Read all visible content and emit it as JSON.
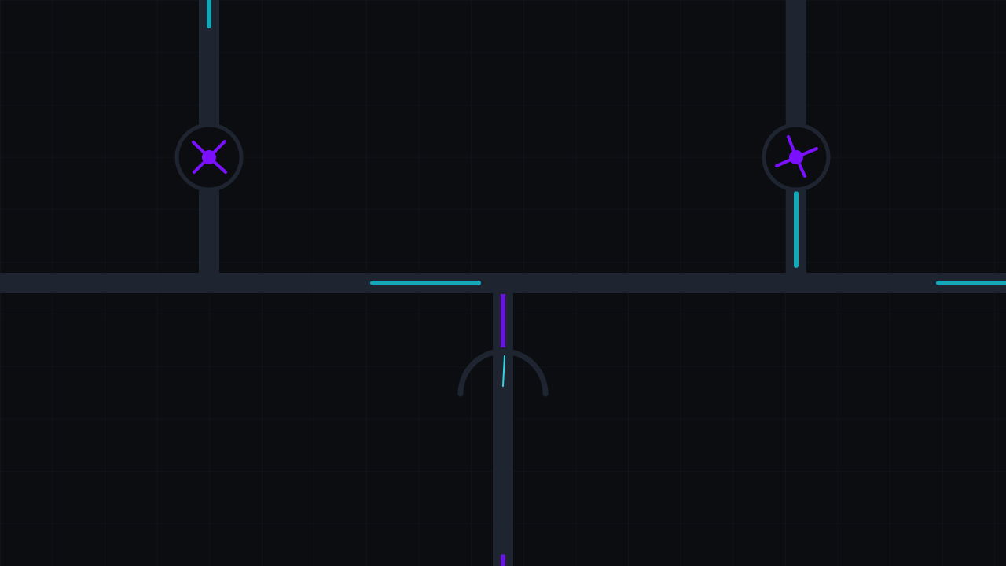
{
  "colors": {
    "background": "#0b0d11",
    "grid": "#141821",
    "pipe": "#1f2530",
    "cyan": "#12a8b8",
    "cyan_bright": "#2fd6e6",
    "purple": "#7b10ff",
    "purple_dark": "#5a10c8"
  },
  "diagram": {
    "pipes": [
      {
        "id": "left-vertical",
        "orientation": "vertical"
      },
      {
        "id": "right-vertical",
        "orientation": "vertical"
      },
      {
        "id": "main-horizontal",
        "orientation": "horizontal"
      },
      {
        "id": "center-vertical",
        "orientation": "vertical"
      }
    ],
    "valves": [
      {
        "id": "left-valve",
        "icon": "fan-icon",
        "state": "idle"
      },
      {
        "id": "right-valve",
        "icon": "fan-icon",
        "state": "rotating"
      }
    ],
    "gauge": {
      "id": "center-gauge",
      "icon": "gauge-icon"
    },
    "flow_segments": [
      {
        "id": "flow-left-top",
        "color": "cyan"
      },
      {
        "id": "flow-right-lower",
        "color": "cyan"
      },
      {
        "id": "flow-main-mid",
        "color": "cyan"
      },
      {
        "id": "flow-main-right",
        "color": "cyan"
      },
      {
        "id": "flow-center-top",
        "color": "purple"
      },
      {
        "id": "flow-center-bottom",
        "color": "purple"
      }
    ]
  }
}
